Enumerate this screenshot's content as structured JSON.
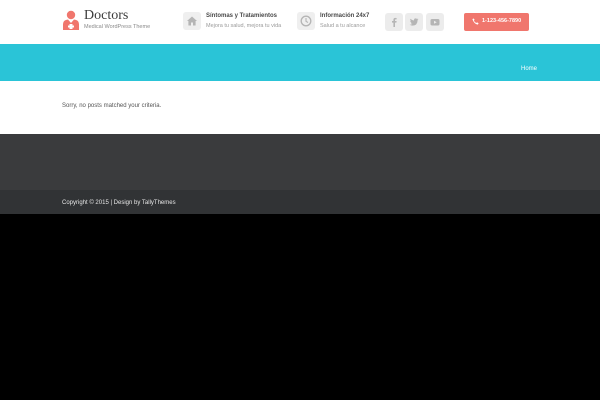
{
  "header": {
    "logo": {
      "title": "Doctors",
      "subtitle": "Medical WordPress Theme"
    },
    "info_items": [
      {
        "icon": "home-icon",
        "title": "Síntomas y Tratamientos",
        "subtitle": "Mejora tu salud, mejora tu vida"
      },
      {
        "icon": "clock-icon",
        "title": "Información 24x7",
        "subtitle": "Salud a tu alcance"
      }
    ],
    "social": [
      "facebook-icon",
      "twitter-icon",
      "youtube-icon"
    ],
    "phone": "1-123-456-7890"
  },
  "banner": {
    "breadcrumb": "Home"
  },
  "content": {
    "message": "Sorry, no posts matched your criteria."
  },
  "footer": {
    "copyright": "Copyright © 2015 | Design by TallyThemes"
  },
  "colors": {
    "accent": "#2ac4d7",
    "button": "#f0766d",
    "footer": "#3a3b3d",
    "footer_bottom": "#313335",
    "background": "#000000"
  }
}
